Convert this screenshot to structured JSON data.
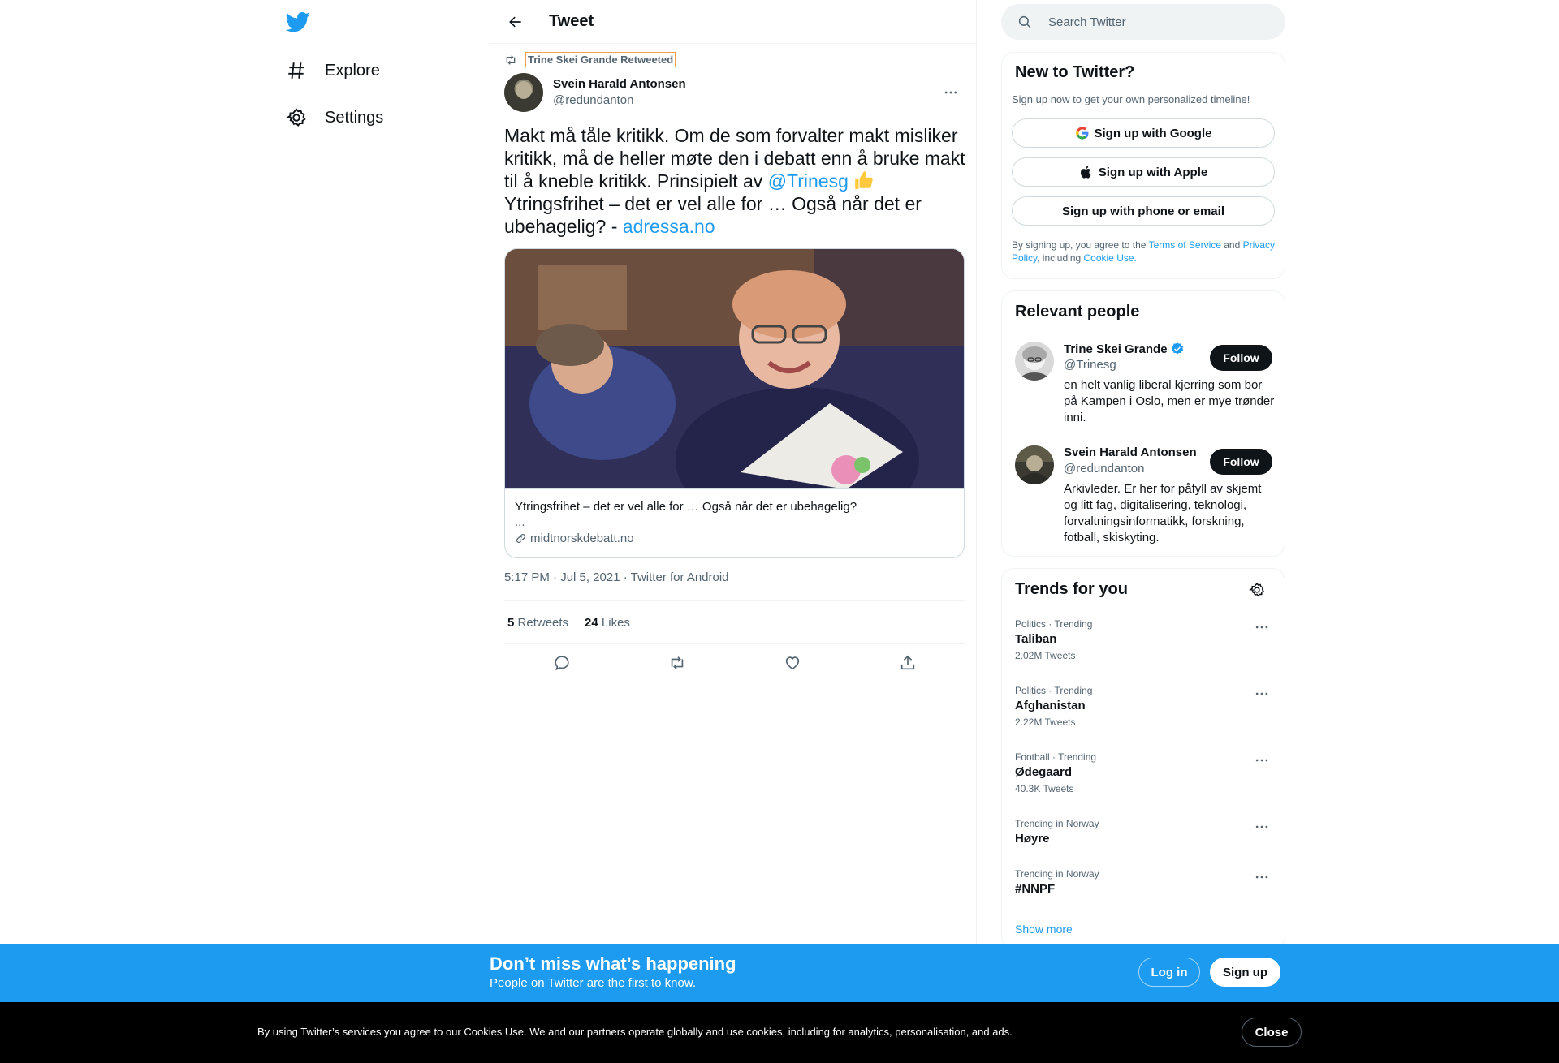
{
  "nav": {
    "logo_icon": "twitter-bird-icon",
    "items": [
      {
        "label": "Explore",
        "icon": "hashtag-icon"
      },
      {
        "label": "Settings",
        "icon": "gear-icon"
      }
    ]
  },
  "header": {
    "title": "Tweet",
    "back_icon": "arrow-left-icon"
  },
  "tweet": {
    "retweeted_by": "Trine Skei Grande Retweeted",
    "author_name": "Svein Harald Antonsen",
    "author_handle": "@redundanton",
    "text_part1": "Makt må tåle kritikk. Om de som forvalter makt misliker kritikk, må de heller møte den i debatt enn å bruke makt til å kneble kritikk. Prinsipielt av ",
    "mention": "@Trinesg",
    "text_part2": " Ytringsfrihet – det er vel alle for … Også når det er ubehagelig? - ",
    "link": "adressa.no",
    "card": {
      "title": "Ytringsfrihet – det er vel alle for … Også når det er ubehagelig?",
      "description": "...",
      "domain": "midtnorskdebatt.no"
    },
    "timestamp": "5:17 PM · Jul 5, 2021 · Twitter for Android",
    "retweets_count": "5",
    "retweets_label": "Retweets",
    "likes_count": "24",
    "likes_label": "Likes"
  },
  "search": {
    "placeholder": "Search Twitter"
  },
  "signup_panel": {
    "title": "New to Twitter?",
    "subtitle": "Sign up now to get your own personalized timeline!",
    "google_label": "Sign up with Google",
    "apple_label": "Sign up with Apple",
    "phone_label": "Sign up with phone or email",
    "legal_prefix": "By signing up, you agree to the ",
    "terms_link": "Terms of Service",
    "legal_and": " and ",
    "privacy_link": "Privacy Policy",
    "legal_including": ", including ",
    "cookie_link": "Cookie Use."
  },
  "people_panel": {
    "title": "Relevant people",
    "people": [
      {
        "name": "Trine Skei Grande",
        "handle": "@Trinesg",
        "bio": "en helt vanlig liberal kjerring som bor på Kampen i Oslo, men er mye trønder inni.",
        "verified": true,
        "follow_label": "Follow"
      },
      {
        "name": "Svein Harald Antonsen",
        "handle": "@redundanton",
        "bio": "Arkivleder. Er her for påfyll av skjemt og litt fag, digitalisering, teknologi, forvaltningsinformatikk, forskning, fotball, skiskyting.",
        "verified": false,
        "follow_label": "Follow"
      }
    ]
  },
  "trends_panel": {
    "title": "Trends for you",
    "trends": [
      {
        "meta": "Politics · Trending",
        "name": "Taliban",
        "count": "2.02M Tweets"
      },
      {
        "meta": "Politics · Trending",
        "name": "Afghanistan",
        "count": "2.22M Tweets"
      },
      {
        "meta": "Football · Trending",
        "name": "Ødegaard",
        "count": "40.3K Tweets"
      },
      {
        "meta": "Trending in Norway",
        "name": "Høyre",
        "count": ""
      },
      {
        "meta": "Trending in Norway",
        "name": "#NNPF",
        "count": ""
      }
    ],
    "show_more": "Show more"
  },
  "signup_bar": {
    "title": "Don’t miss what’s happening",
    "subtitle": "People on Twitter are the first to know.",
    "login_label": "Log in",
    "signup_label": "Sign up"
  },
  "cookie_bar": {
    "text": "By using Twitter’s services you agree to our Cookies Use. We and our partners operate globally and use cookies, including for analytics, personalisation, and ads.",
    "close_label": "Close"
  },
  "colors": {
    "accent": "#1d9bf0",
    "text": "#0f1419",
    "muted": "#536471",
    "border": "#eff3f4"
  }
}
